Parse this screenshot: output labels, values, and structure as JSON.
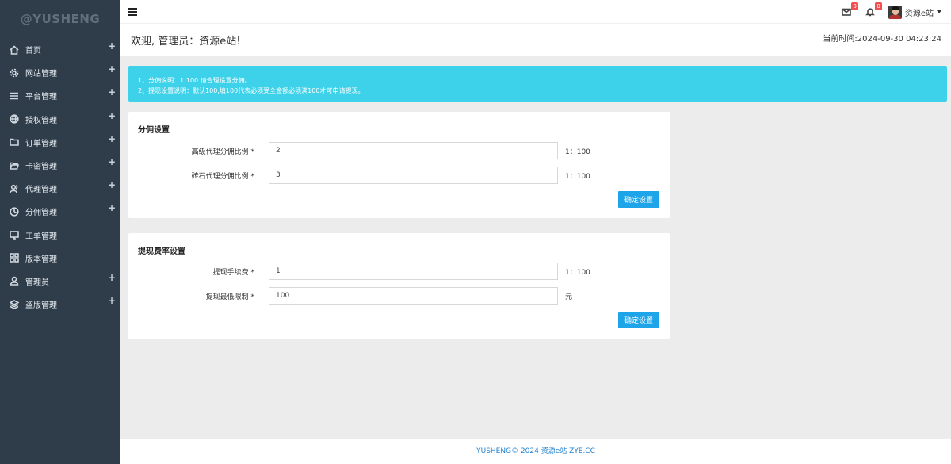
{
  "sidebar": {
    "logo": "@YUSHENG",
    "items": [
      {
        "label": "首页",
        "icon": "home-icon",
        "expand": "+"
      },
      {
        "label": "网站管理",
        "icon": "gear-icon",
        "expand": "+"
      },
      {
        "label": "平台管理",
        "icon": "list-icon",
        "expand": "+"
      },
      {
        "label": "授权管理",
        "icon": "globe-icon",
        "expand": "+"
      },
      {
        "label": "订单管理",
        "icon": "folder-icon",
        "expand": "+"
      },
      {
        "label": "卡密管理",
        "icon": "folder-open-icon",
        "expand": "+"
      },
      {
        "label": "代理管理",
        "icon": "users-icon",
        "expand": "+"
      },
      {
        "label": "分佣管理",
        "icon": "pie-icon",
        "expand": "+"
      },
      {
        "label": "工单管理",
        "icon": "monitor-icon",
        "expand": ""
      },
      {
        "label": "版本管理",
        "icon": "grid-icon",
        "expand": ""
      },
      {
        "label": "管理员",
        "icon": "user-icon",
        "expand": "+"
      },
      {
        "label": "盗版管理",
        "icon": "layers-icon",
        "expand": "+"
      }
    ]
  },
  "topbar": {
    "mail_badge": "0",
    "bell_badge": "0",
    "username": "资源e站"
  },
  "header": {
    "welcome": "欢迎, 管理员：资源e站!",
    "current_time": "当前时间:2024-09-30 04:23:24"
  },
  "alert": {
    "line1": "1、分佣说明：1:100 请合理设置分佣。",
    "line2": "2、提现设置说明：默认100,填100代表必须受全金额必须满100才可申请提现。"
  },
  "commission": {
    "title": "分佣设置",
    "fields": [
      {
        "label": "高级代理分佣比例 *",
        "value": "2",
        "suffix": "1：100"
      },
      {
        "label": "砖石代理分佣比例 *",
        "value": "3",
        "suffix": "1：100"
      }
    ],
    "button": "确定设置"
  },
  "withdraw": {
    "title": "提现费率设置",
    "fields": [
      {
        "label": "提现手续费 *",
        "value": "1",
        "suffix": "1：100"
      },
      {
        "label": "提现最低限制 *",
        "value": "100",
        "suffix": "元"
      }
    ],
    "button": "确定设置"
  },
  "footer": {
    "text": "YUSHENG© 2024 资源e站 ZYE.CC"
  }
}
